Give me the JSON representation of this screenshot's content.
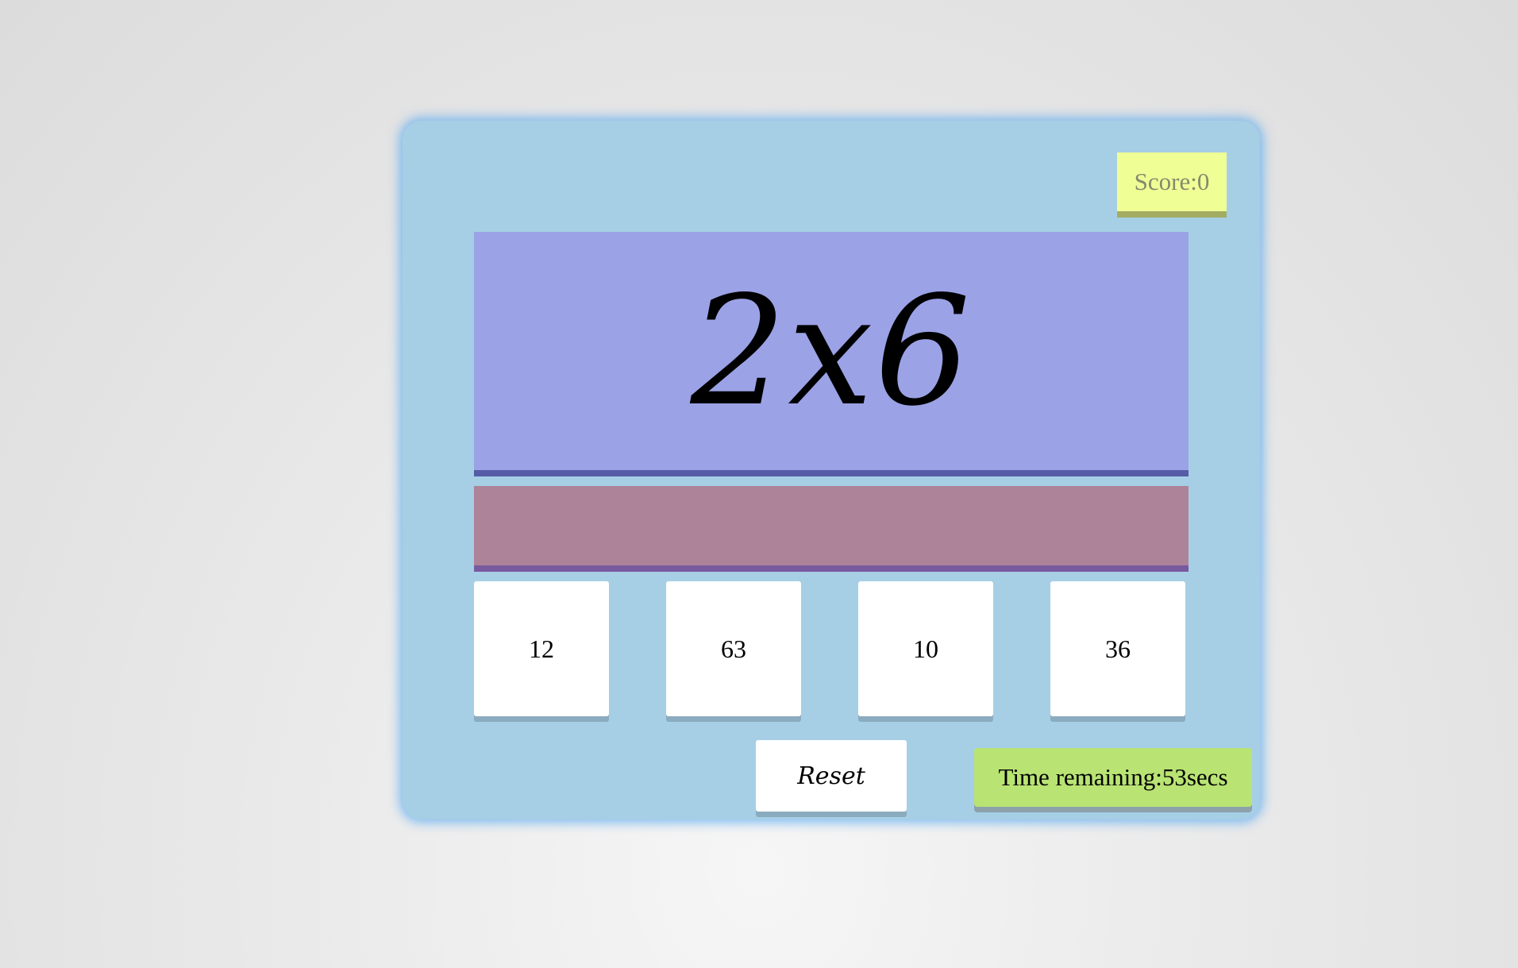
{
  "score": {
    "label": "Score:",
    "value": "0"
  },
  "question": {
    "text": "2x6"
  },
  "instruction": {
    "text": ""
  },
  "choices": [
    {
      "label": "12"
    },
    {
      "label": "63"
    },
    {
      "label": "10"
    },
    {
      "label": "36"
    }
  ],
  "reset": {
    "label": "Reset"
  },
  "timer": {
    "label": "Time remaining:",
    "value": "53",
    "unit": "secs"
  },
  "colors": {
    "background": "#e6e6e6",
    "container": "#a6cfe6",
    "score_box": "#f0fe96",
    "question_box": "#9ba2e6",
    "instruction_box": "#ad8399",
    "choice_box": "#ffffff",
    "timer_box": "#b9e373"
  }
}
